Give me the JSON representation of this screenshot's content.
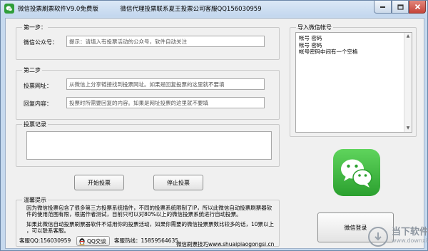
{
  "titlebar": {
    "app_title": "微信投票刷票软件V9.0免费版",
    "service_text": "微信代理投票联系夏王投票公司客服QQ156030959"
  },
  "step1": {
    "title": "第一步：",
    "label": "微信公众号：",
    "value": "提示：请填入有投票活动的公众号，软件自动关注"
  },
  "step2": {
    "title": "第二步",
    "url_label": "投票网址：",
    "url_value": "从微信上分享链接找到投票网址。如果是回复投票的这里就不要填",
    "reply_label": "回复内容：",
    "reply_value": "投票时所需要回复的内容。如果是网址投票的这里就不要填"
  },
  "vote_log": {
    "title": "投票记录",
    "content": ""
  },
  "buttons": {
    "start_vote": "开始投票",
    "stop_vote": "停止投票",
    "wechat_login": "微信登录"
  },
  "notice": {
    "title": "温馨提示",
    "lines": [
      "因为微信投票包含了很多第三方投票系统插件，不同的投票系统限制了IP，所以此微信自动投票刷票器软",
      "件的使用范围有限，根据作者测试，目前只可以对80%以上的微信投票系统进行自动投票。",
      "如果此微信自动投票刷票器软件不适用你的投票活动，如果你需要的微信投票票数比较多的话，10票以上",
      "，可以联系客服。"
    ],
    "qq_text": "客服QQ:156030959",
    "qq_chat": "QQ交谈",
    "hotline": "客服热线：15859564635",
    "website": "微信刷票技巧www.shuaipiaogongsi.cn"
  },
  "import_accounts": {
    "title": "导入微信帐号",
    "lines": [
      "帐号 密码",
      "帐号 密码",
      "帐号密码中间有一个空格"
    ]
  },
  "watermark": {
    "title": "当下软件园",
    "url": "www.downxia.com"
  },
  "colors": {
    "wechat_green": "#2ba02f",
    "window_frame": "#c6d9ee",
    "close_red": "#c5453a"
  },
  "icons": [
    "app-icon",
    "minimize-icon",
    "maximize-icon",
    "close-icon",
    "qq-penguin-icon",
    "wechat-logo-icon"
  ]
}
